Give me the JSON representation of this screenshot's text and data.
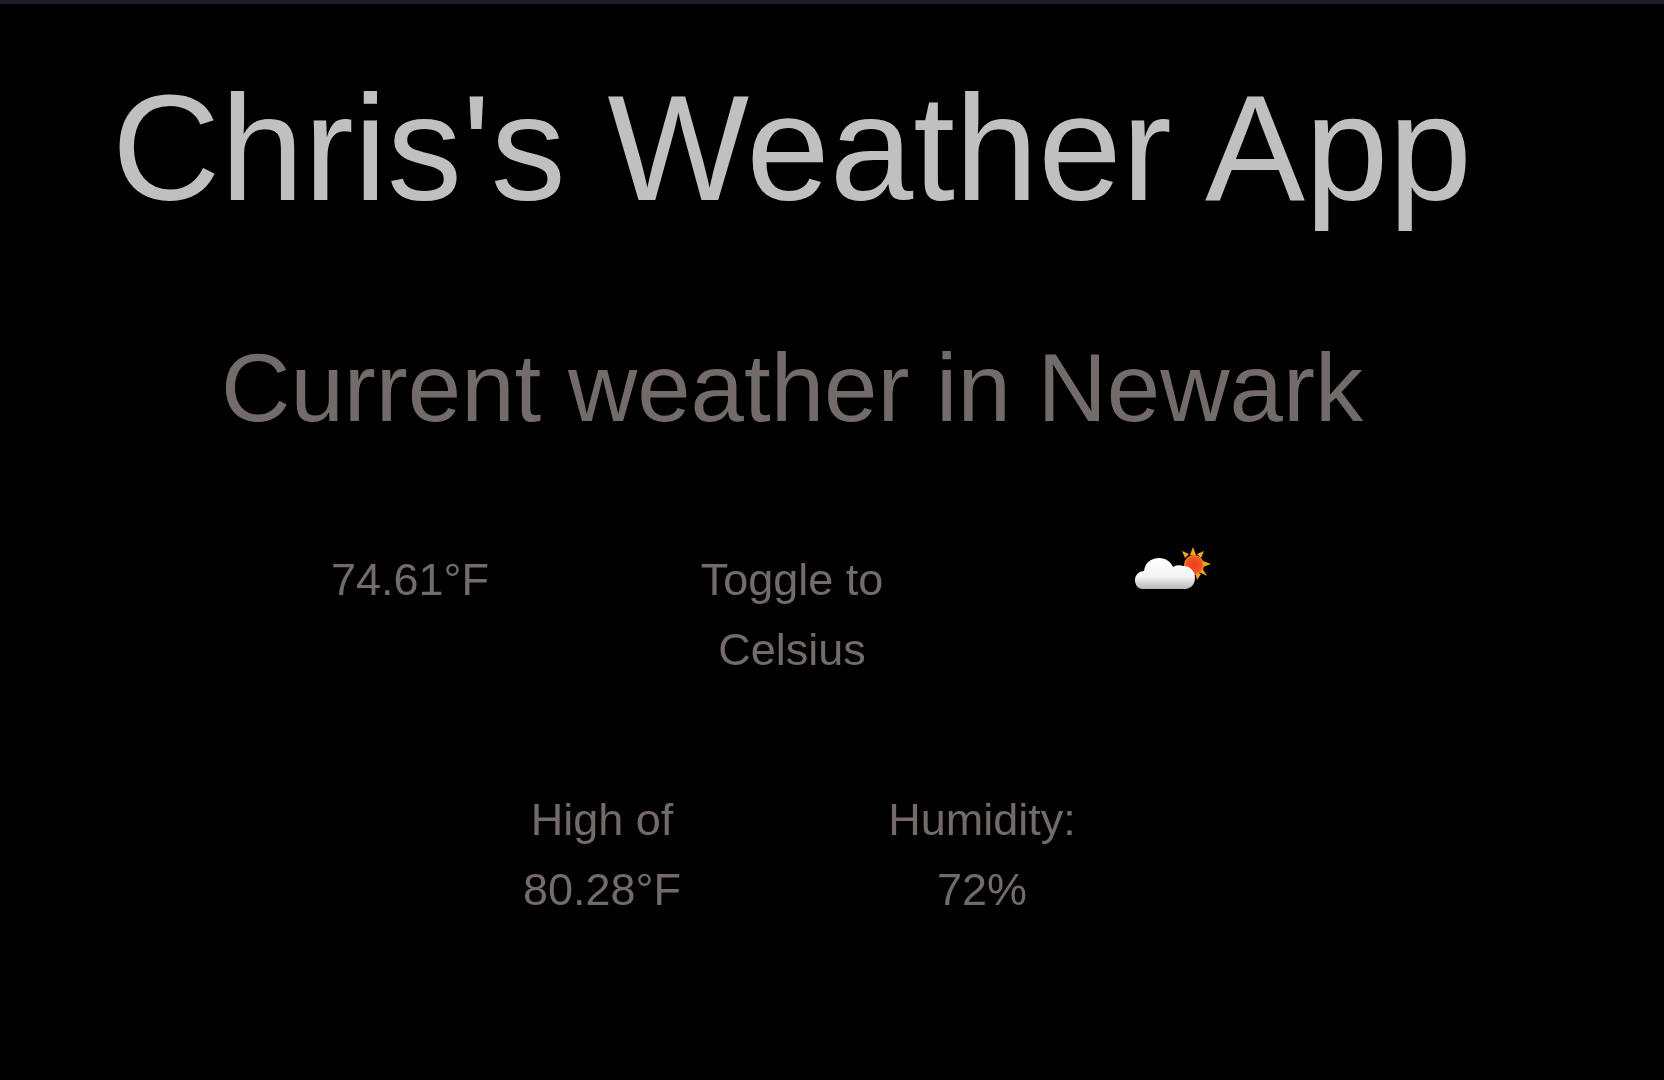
{
  "app_title": "Chris's Weather App",
  "heading": "Current weather in Newark",
  "current": {
    "temperature": "74.61°F",
    "toggle": "Toggle to Celsius"
  },
  "details": [
    {
      "label": "High of",
      "value": "80.28°F"
    },
    {
      "label": "Humidity:",
      "value": "72%"
    }
  ]
}
